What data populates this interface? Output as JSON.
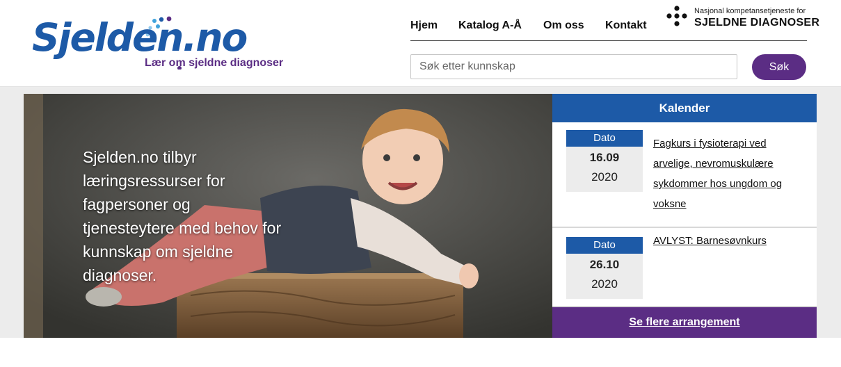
{
  "logo": {
    "name": "Sjelden",
    "suffix": ".no",
    "tagline": "Lær om sjeldne diagnoser"
  },
  "nav": {
    "items": [
      "Hjem",
      "Katalog A-Å",
      "Om oss",
      "Kontakt"
    ]
  },
  "partner": {
    "small": "Nasjonal kompetansetjeneste for",
    "big": "SJELDNE DIAGNOSER"
  },
  "search": {
    "placeholder": "Søk etter kunnskap",
    "button": "Søk"
  },
  "hero": {
    "text": "Sjelden.no tilbyr læringsressurser for fagpersoner og tjenesteytere med behov for kunnskap om sjeldne diagnoser."
  },
  "calendar": {
    "title": "Kalender",
    "events": [
      {
        "date_label": "Dato",
        "day": "16.09",
        "year": "2020",
        "title": "Fagkurs i fysioterapi ved arvelige, nevromuskulære sykdommer hos ungdom og voksne"
      },
      {
        "date_label": "Dato",
        "day": "26.10",
        "year": "2020",
        "title": "AVLYST: Barnesøvnkurs"
      }
    ],
    "more": "Se flere arrangement"
  },
  "colors": {
    "brand_blue": "#1d5aa7",
    "brand_purple": "#5b2d84"
  }
}
